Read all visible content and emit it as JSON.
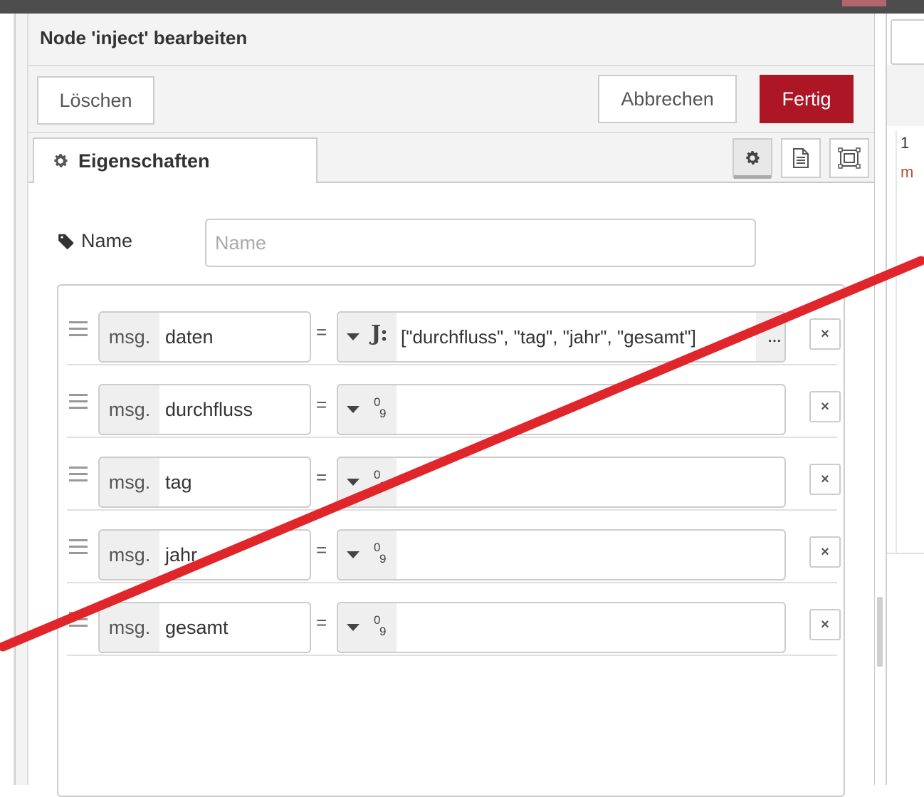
{
  "dialog": {
    "title": "Node 'inject' bearbeiten",
    "delete_label": "Löschen",
    "cancel_label": "Abbrechen",
    "done_label": "Fertig"
  },
  "tab": {
    "label": "Eigenschaften",
    "icon": "gear-icon"
  },
  "tab_icons": [
    "gear-icon",
    "document-icon",
    "appearance-icon"
  ],
  "name_field": {
    "label": "Name",
    "placeholder": "Name",
    "value": ""
  },
  "properties": [
    {
      "prefix": "msg.",
      "property": "daten",
      "type": "json",
      "value": "[\"durchfluss\", \"tag\", \"jahr\", \"gesamt\"]"
    },
    {
      "prefix": "msg.",
      "property": "durchfluss",
      "type": "num",
      "value": ""
    },
    {
      "prefix": "msg.",
      "property": "tag",
      "type": "num",
      "value": ""
    },
    {
      "prefix": "msg.",
      "property": "jahr",
      "type": "num",
      "value": ""
    },
    {
      "prefix": "msg.",
      "property": "gesamt",
      "type": "num",
      "value": ""
    }
  ],
  "labels": {
    "equals": "=",
    "num_type_top": "0",
    "num_type_bottom": "9",
    "json_type": "J:",
    "remove": "×"
  },
  "right_panel": {
    "line1": "1",
    "line2": "m"
  },
  "colors": {
    "primary_button": "#ad1625",
    "strike_line": "#e0262b",
    "topbar": "#4d4d4d"
  }
}
